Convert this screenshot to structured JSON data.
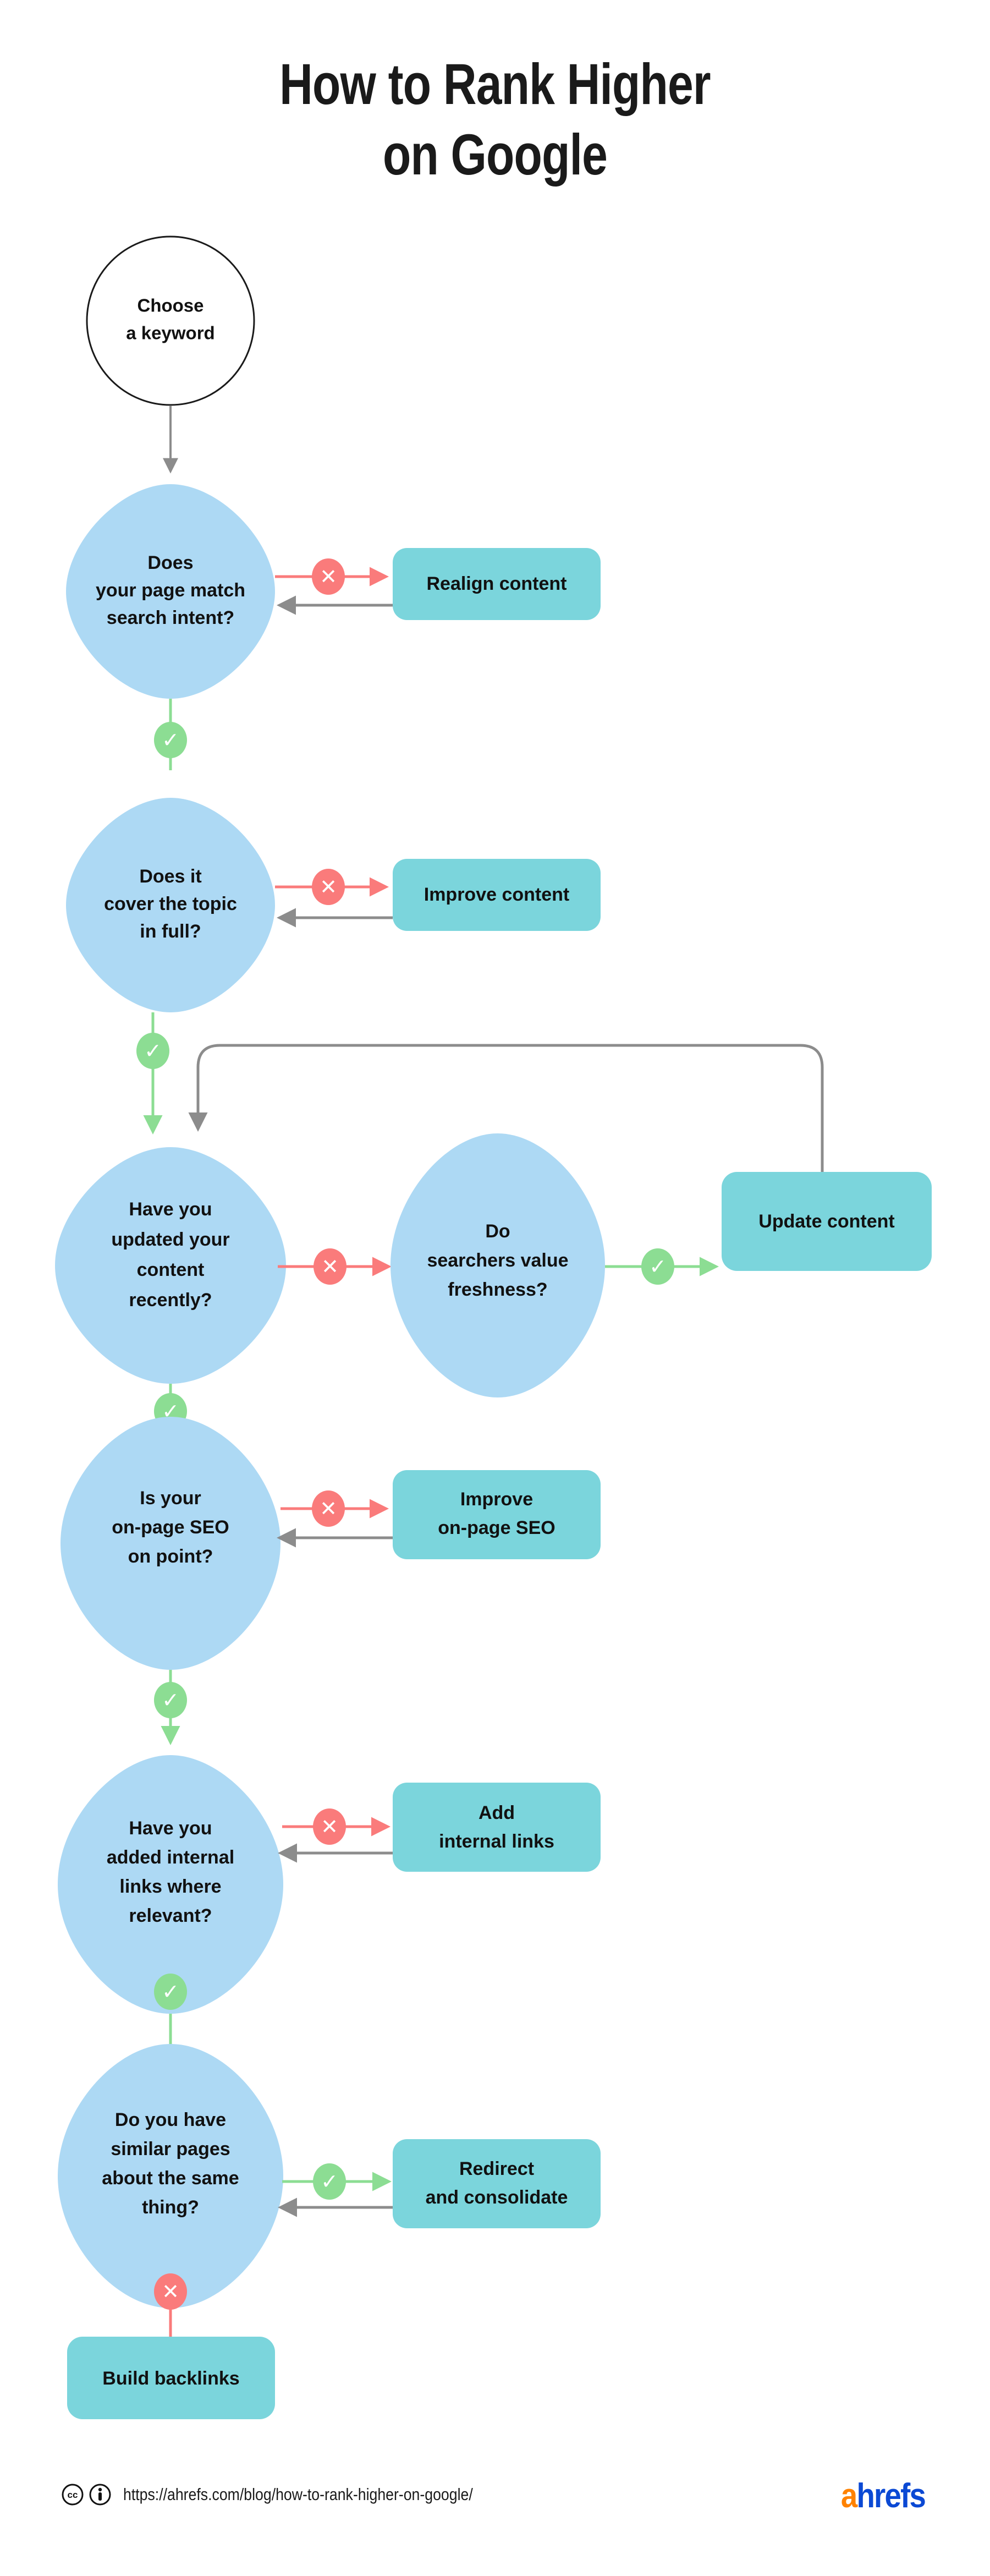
{
  "title": "How to Rank Higher\non Google",
  "colors": {
    "decision_fill": "#ADD9F4",
    "action_fill": "#7BD5DC",
    "yes_green": "#8CDD93",
    "no_red": "#FA7B7B",
    "loop_gray": "#8C8C8C",
    "text_dark": "#111111",
    "start_stroke": "#1a1a1a",
    "logo_orange": "#FF8200",
    "logo_blue": "#0B49D4"
  },
  "start_node": {
    "label": "Choose\na keyword",
    "shape": "circle"
  },
  "steps": [
    {
      "id": "search-intent",
      "question": "Does\nyour page match\nsearch intent?",
      "no_action": "Realign content",
      "no_badge": "x",
      "yes_badge": "check",
      "loopback": "return"
    },
    {
      "id": "topic-coverage",
      "question": "Does it\ncover the topic\nin full?",
      "no_action": "Improve content",
      "no_badge": "x",
      "yes_badge": "check",
      "loopback": "return"
    },
    {
      "id": "content-freshness",
      "question": "Have you\nupdated your\ncontent\nrecently?",
      "no_badge": "x",
      "yes_badge": "check",
      "sub_question": "Do\nsearchers value\nfreshness?",
      "sub_yes_badge": "check",
      "sub_action": "Update content",
      "loopback": "return-top"
    },
    {
      "id": "on-page-seo",
      "question": "Is your\non-page SEO\non point?",
      "no_action": "Improve\non-page SEO",
      "no_badge": "x",
      "yes_badge": "check",
      "loopback": "return"
    },
    {
      "id": "internal-links",
      "question": "Have you\nadded internal\nlinks where\nrelevant?",
      "no_action": "Add\ninternal links",
      "no_badge": "x",
      "yes_badge": "check",
      "loopback": "return"
    },
    {
      "id": "duplicate-pages",
      "question": "Do you have\nsimilar pages\nabout the same\nthing?",
      "yes_action": "Redirect\nand consolidate",
      "yes_badge": "check",
      "no_badge": "x",
      "loopback": "return"
    }
  ],
  "end_node": {
    "label": "Build backlinks"
  },
  "badges": {
    "check_glyph": "✓",
    "x_glyph": "✕"
  },
  "footer": {
    "url": "https://ahrefs.com/blog/how-to-rank-higher-on-google/",
    "cc_icon": "creative-commons-icon",
    "by_icon": "creative-commons-by-icon",
    "logo_a": "a",
    "logo_rest": "hrefs"
  }
}
